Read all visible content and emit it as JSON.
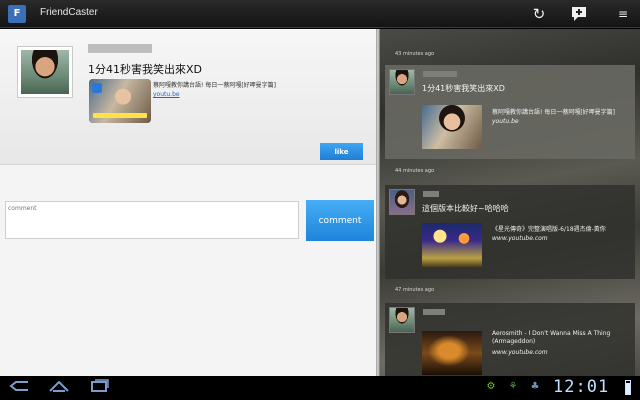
{
  "app": {
    "title": "FriendCaster",
    "icon_letter": "F"
  },
  "actionbar": {
    "refresh_icon": "refresh-icon",
    "compose_icon": "new-post-icon",
    "menu_icon": "overflow-menu-icon"
  },
  "post": {
    "message": "1分41秒害我笑出來XD",
    "link_description": "蔡阿嘎教你講台語! 每日一蔡阿嘎[好呷曼字篇]",
    "link_host": "youtu.be",
    "like_label": "like"
  },
  "comment": {
    "placeholder": "comment",
    "button_label": "comment"
  },
  "feed": {
    "items": [
      {
        "time": "43 minutes ago",
        "message": "1分41秒害我笑出來XD",
        "link_description": "蔡阿嘎教你講台語! 每日一蔡阿嘎[好呷曼字篇]",
        "link_host": "youtu.be"
      },
      {
        "time": "44 minutes ago",
        "message": "這個版本比較好~哈哈哈",
        "link_description": "《星光傳奇》完整演唱版-6/18週杰倫-黃你",
        "link_host": "www.youtube.com"
      },
      {
        "time": "47 minutes ago",
        "message": "",
        "link_description": "Aerosmith - I Don't Wanna Miss A Thing (Armageddon)",
        "link_host": "www.youtube.com"
      }
    ]
  },
  "system": {
    "clock": "12:01",
    "battery_level": 0.85
  },
  "colors": {
    "accent": "#2a8fe6",
    "actionbar": "#1e1e1e"
  }
}
